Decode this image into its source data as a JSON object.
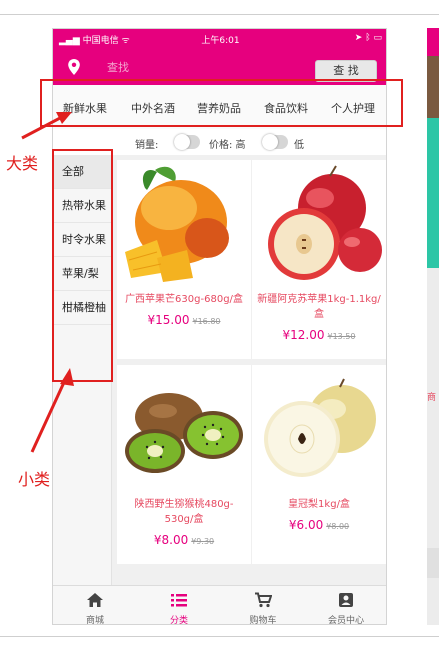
{
  "status_bar": {
    "carrier": "中国电信",
    "time": "上午6:01"
  },
  "search": {
    "placeholder": "查找",
    "button": "查 找"
  },
  "categories": [
    "新鲜水果",
    "中外名酒",
    "营养奶品",
    "食品饮料",
    "个人护理"
  ],
  "active_category": "新鲜水果",
  "filter": {
    "sales_label": "销量:",
    "price_label": "价格: 高",
    "low_label": "低"
  },
  "subcategories": [
    "全部",
    "热带水果",
    "时令水果",
    "苹果/梨",
    "柑橘橙柚"
  ],
  "products": [
    {
      "name": "广西苹果芒630g-680g/盒",
      "price": "¥15.00",
      "original_price": "¥16.80",
      "image": "mango"
    },
    {
      "name": "新疆阿克苏苹果1kg-1.1kg/盒",
      "price": "¥12.00",
      "original_price": "¥13.50",
      "image": "apple"
    },
    {
      "name": "陕西野生猕猴桃480g-530g/盒",
      "price": "¥8.00",
      "original_price": "¥9.30",
      "image": "kiwi"
    },
    {
      "name": "皇冠梨1kg/盒",
      "price": "¥6.00",
      "original_price": "¥8.00",
      "image": "pear"
    }
  ],
  "tabbar": [
    {
      "label": "商城",
      "icon": "home-icon"
    },
    {
      "label": "分类",
      "icon": "list-icon"
    },
    {
      "label": "购物车",
      "icon": "cart-icon"
    },
    {
      "label": "会员中心",
      "icon": "member-icon"
    }
  ],
  "active_tab": "分类",
  "annotations": {
    "major_category": "大类",
    "minor_category": "小类"
  },
  "colors": {
    "brand": "#e6007e",
    "price_text": "#e64960",
    "annotation": "#e0201f"
  }
}
